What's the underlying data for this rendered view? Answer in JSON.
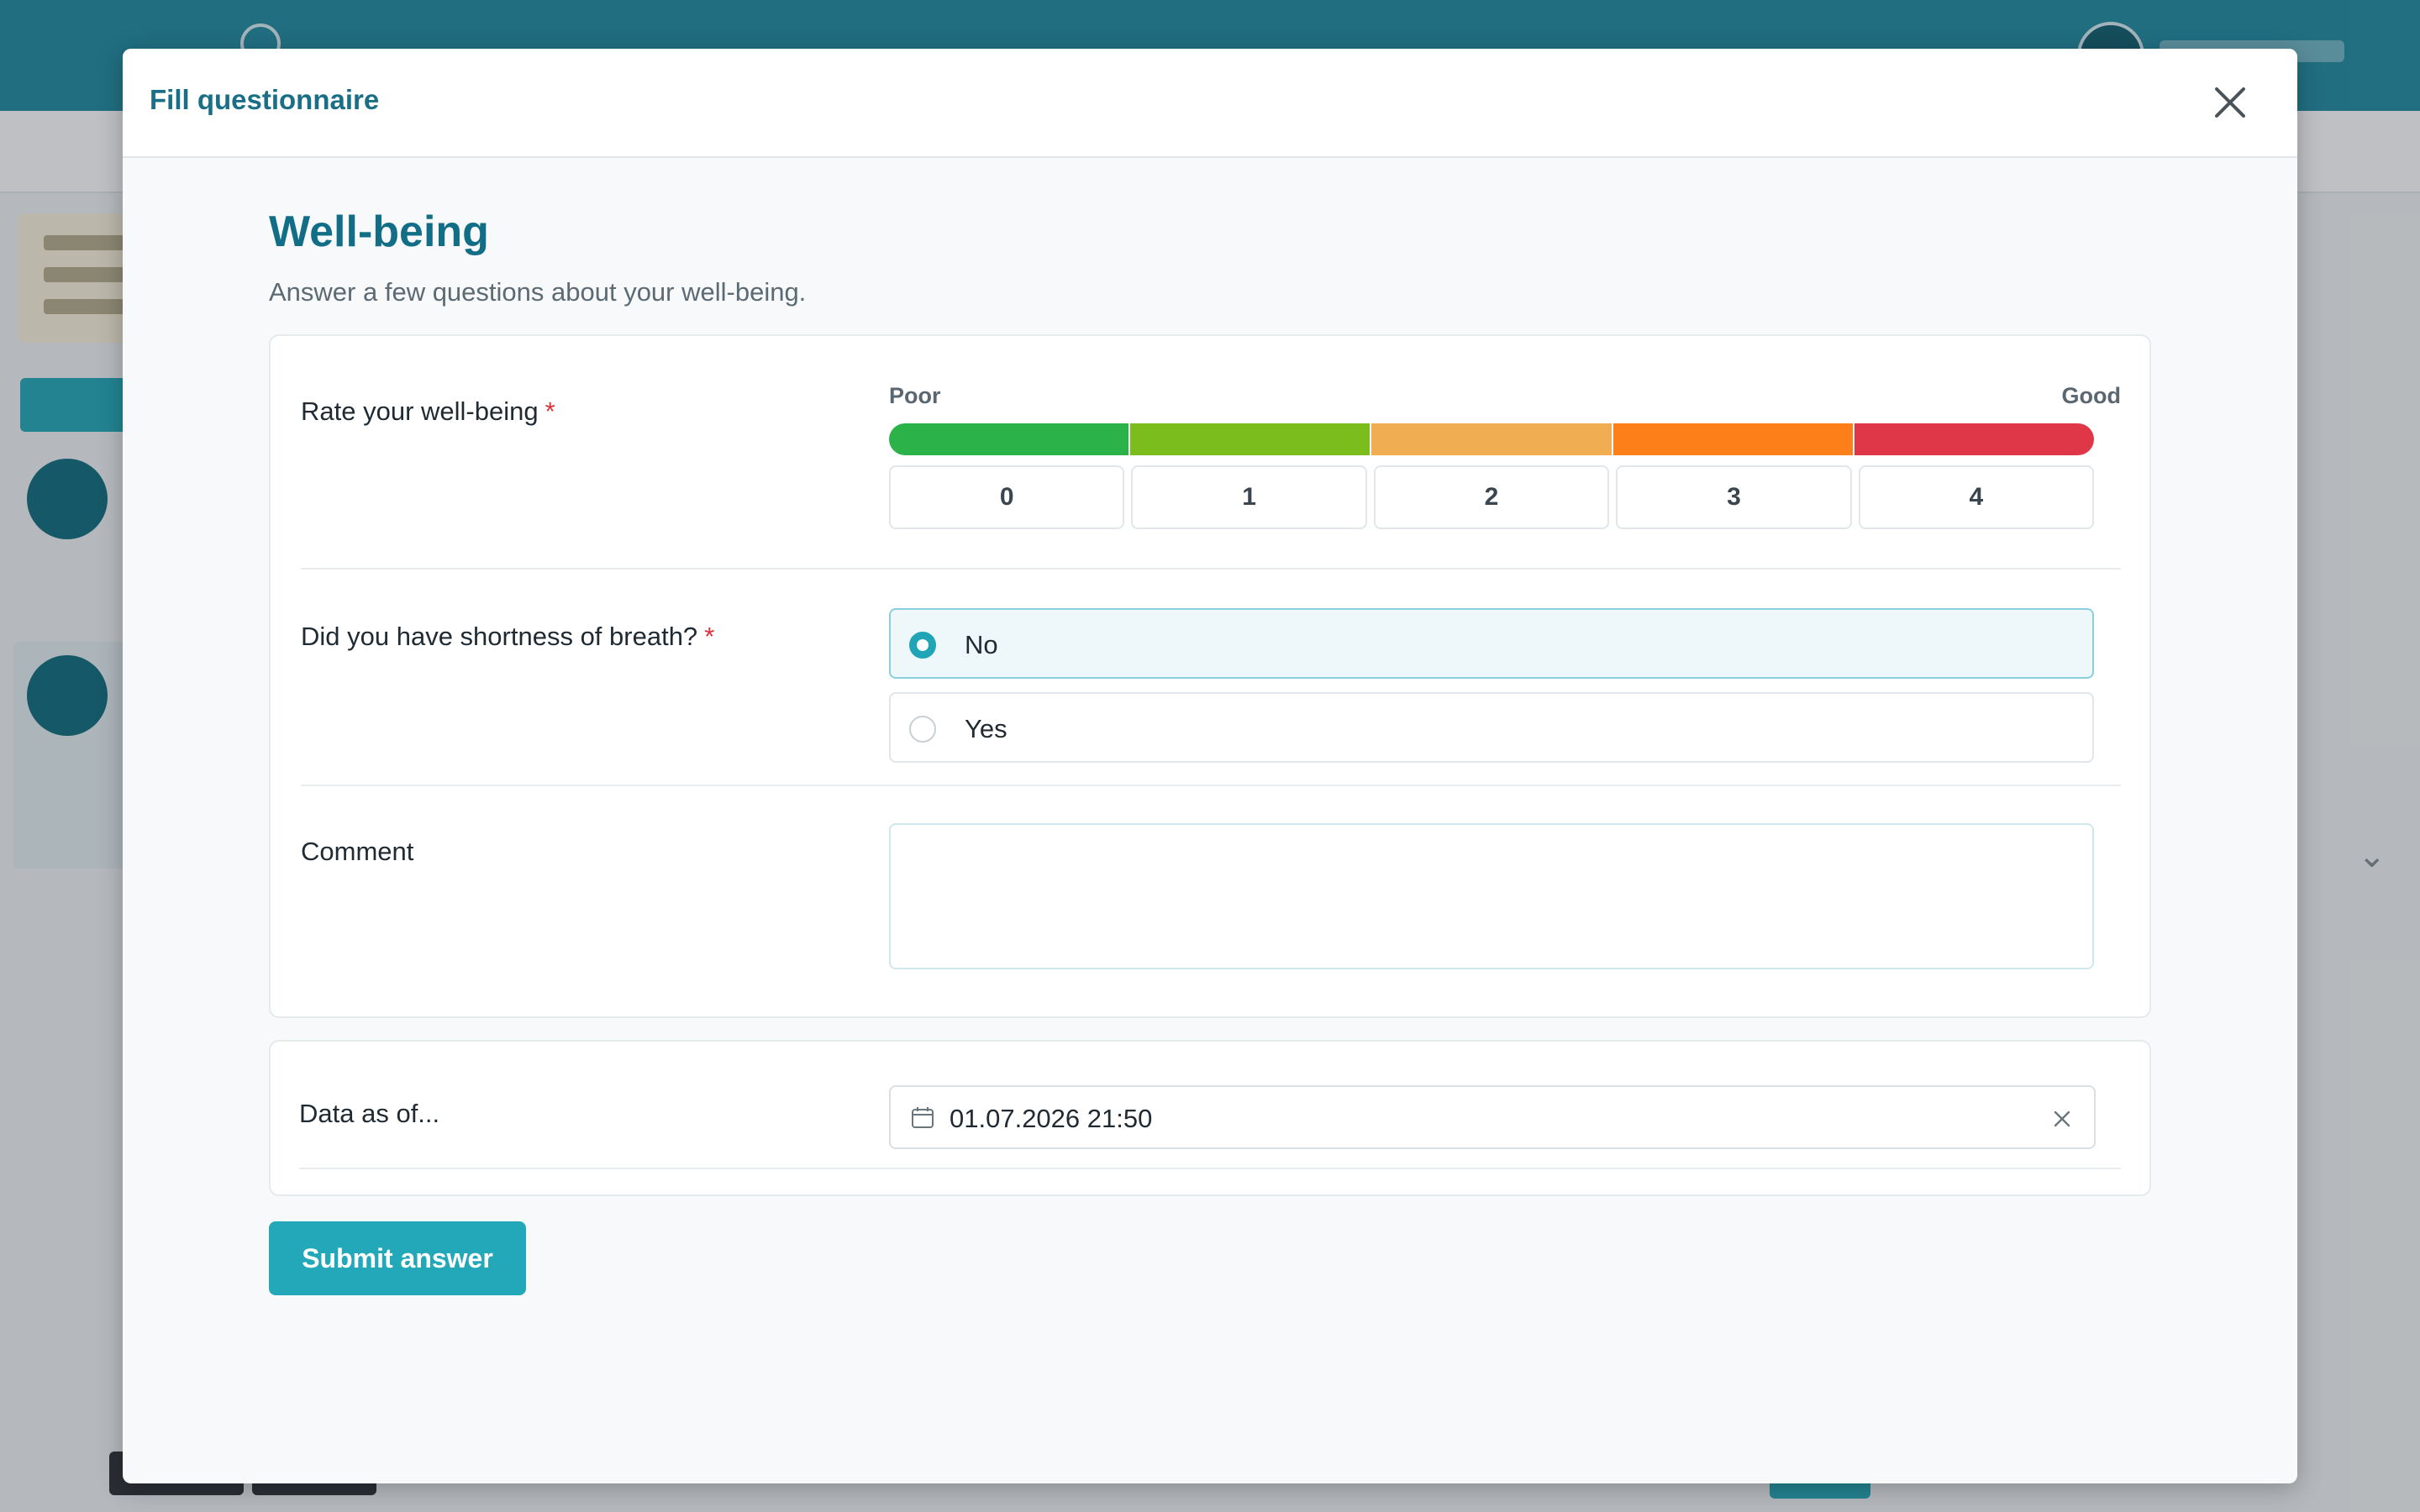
{
  "modal": {
    "title": "Fill questionnaire",
    "close_icon": "close-icon"
  },
  "questionnaire": {
    "title": "Well-being",
    "description": "Answer a few questions about your well-being."
  },
  "questions": {
    "rating": {
      "label": "Rate your well-being",
      "required_mark": "*",
      "scale_low": "Poor",
      "scale_high": "Good",
      "options": [
        "0",
        "1",
        "2",
        "3",
        "4"
      ],
      "colors": [
        "#2bb34a",
        "#7abd1c",
        "#f0ad52",
        "#fd7f1a",
        "#e03748"
      ]
    },
    "breath": {
      "label": "Did you have shortness of breath?",
      "required_mark": "*",
      "options": [
        "No",
        "Yes"
      ],
      "selected": "No"
    },
    "comment": {
      "label": "Comment",
      "value": ""
    }
  },
  "data_as_of": {
    "label": "Data as of...",
    "value": "01.07.2026 21:50",
    "calendar_icon": "calendar-icon",
    "clear_icon": "clear-icon"
  },
  "submit_label": "Submit answer",
  "colors": {
    "accent": "#22a8b8",
    "title": "#116e86"
  }
}
